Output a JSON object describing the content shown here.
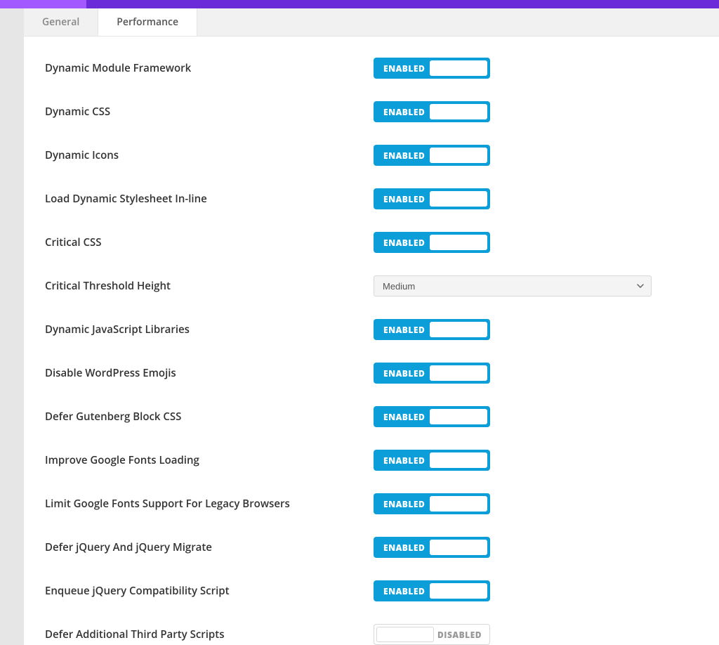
{
  "tabs": {
    "general": "General",
    "performance": "Performance",
    "active": "performance"
  },
  "toggle_labels": {
    "enabled": "ENABLED",
    "disabled": "DISABLED"
  },
  "select_threshold": {
    "value": "Medium"
  },
  "rows": {
    "dynamic_module_framework": {
      "label": "Dynamic Module Framework",
      "state": "enabled"
    },
    "dynamic_css": {
      "label": "Dynamic CSS",
      "state": "enabled"
    },
    "dynamic_icons": {
      "label": "Dynamic Icons",
      "state": "enabled"
    },
    "load_dynamic_stylesheet": {
      "label": "Load Dynamic Stylesheet In-line",
      "state": "enabled"
    },
    "critical_css": {
      "label": "Critical CSS",
      "state": "enabled"
    },
    "critical_threshold_height": {
      "label": "Critical Threshold Height"
    },
    "dynamic_js_libraries": {
      "label": "Dynamic JavaScript Libraries",
      "state": "enabled"
    },
    "disable_wp_emojis": {
      "label": "Disable WordPress Emojis",
      "state": "enabled"
    },
    "defer_gutenberg_css": {
      "label": "Defer Gutenberg Block CSS",
      "state": "enabled"
    },
    "improve_google_fonts": {
      "label": "Improve Google Fonts Loading",
      "state": "enabled"
    },
    "limit_google_fonts_legacy": {
      "label": "Limit Google Fonts Support For Legacy Browsers",
      "state": "enabled"
    },
    "defer_jquery_migrate": {
      "label": "Defer jQuery And jQuery Migrate",
      "state": "enabled"
    },
    "enqueue_jquery_compat": {
      "label": "Enqueue jQuery Compatibility Script",
      "state": "enabled"
    },
    "defer_third_party": {
      "label": "Defer Additional Third Party Scripts",
      "state": "disabled"
    }
  }
}
